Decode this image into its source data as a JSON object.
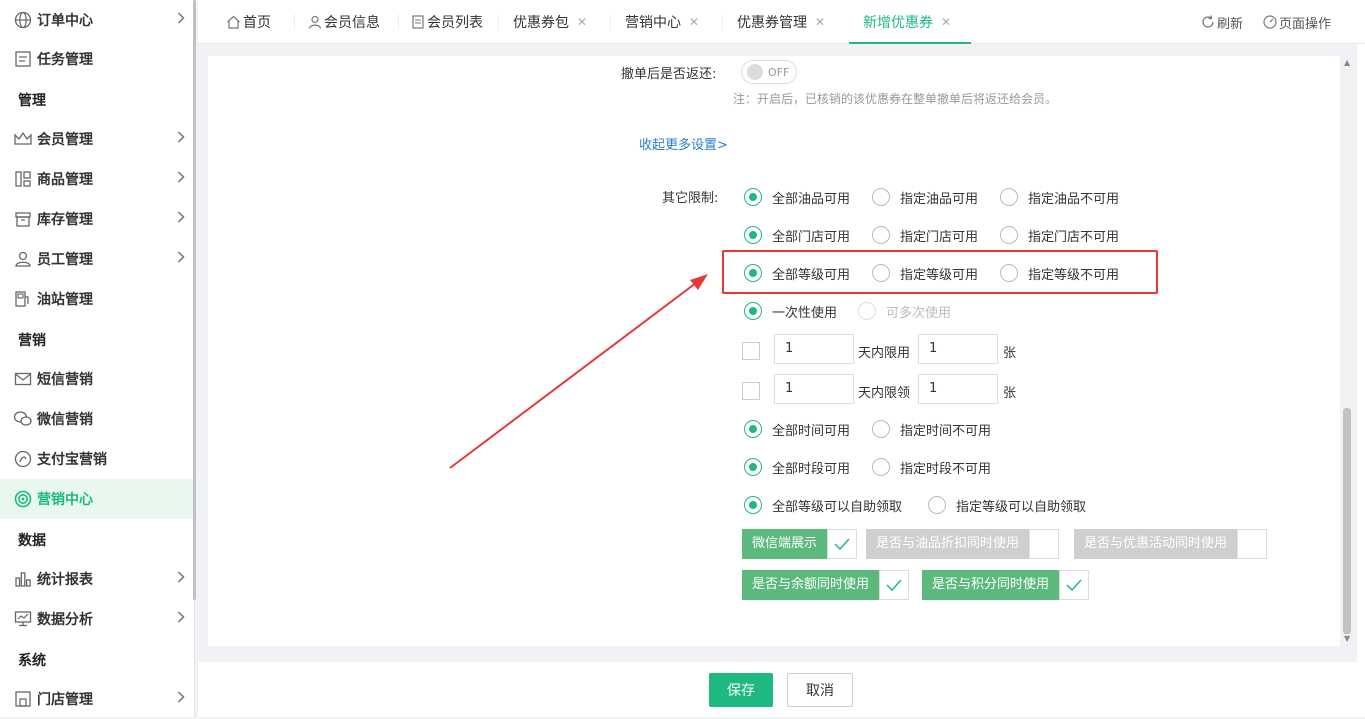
{
  "sidebar": {
    "items": [
      {
        "label": "订单中心"
      },
      {
        "label": "任务管理"
      },
      {
        "label": "会员管理"
      },
      {
        "label": "商品管理"
      },
      {
        "label": "库存管理"
      },
      {
        "label": "员工管理"
      },
      {
        "label": "油站管理"
      },
      {
        "label": "短信营销"
      },
      {
        "label": "微信营销"
      },
      {
        "label": "支付宝营销"
      },
      {
        "label": "营销中心"
      },
      {
        "label": "统计报表"
      },
      {
        "label": "数据分析"
      },
      {
        "label": "门店管理"
      }
    ],
    "groups": [
      "管理",
      "营销",
      "数据",
      "系统"
    ]
  },
  "tabs": [
    {
      "label": "首页"
    },
    {
      "label": "会员信息"
    },
    {
      "label": "会员列表"
    },
    {
      "label": "优惠券包"
    },
    {
      "label": "营销中心"
    },
    {
      "label": "优惠券管理"
    },
    {
      "label": "新增优惠券"
    }
  ],
  "toolbar": {
    "refresh": "刷新",
    "page_ops": "页面操作"
  },
  "form": {
    "refund_label": "撤单后是否返还:",
    "toggle_text": "OFF",
    "refund_note": "注：开启后，已核销的该优惠券在整单撤单后将返还给会员。",
    "collapse_link": "收起更多设置>",
    "other_limit_label": "其它限制:",
    "oil_row": [
      "全部油品可用",
      "指定油品可用",
      "指定油品不可用"
    ],
    "store_row": [
      "全部门店可用",
      "指定门店可用",
      "指定门店不可用"
    ],
    "level_row": [
      "全部等级可用",
      "指定等级可用",
      "指定等级不可用"
    ],
    "use_row": [
      "一次性使用",
      "可多次使用"
    ],
    "limit_use": {
      "days": "1",
      "mid": "天内限用",
      "count": "1",
      "unit": "张"
    },
    "limit_get": {
      "days": "1",
      "mid": "天内限领",
      "count": "1",
      "unit": "张"
    },
    "time_row": [
      "全部时间可用",
      "指定时间不可用"
    ],
    "period_row": [
      "全部时段可用",
      "指定时段不可用"
    ],
    "self_row": [
      "全部等级可以自助领取",
      "指定等级可以自助领取"
    ],
    "switches_row1": [
      "微信端展示",
      "是否与油品折扣同时使用",
      "是否与优惠活动同时使用"
    ],
    "switches_row2": [
      "是否与余额同时使用",
      "是否与积分同时使用"
    ]
  },
  "footer": {
    "save": "保存",
    "cancel": "取消"
  },
  "colors": {
    "accent": "#1eb980",
    "highlight": "#e53935"
  }
}
